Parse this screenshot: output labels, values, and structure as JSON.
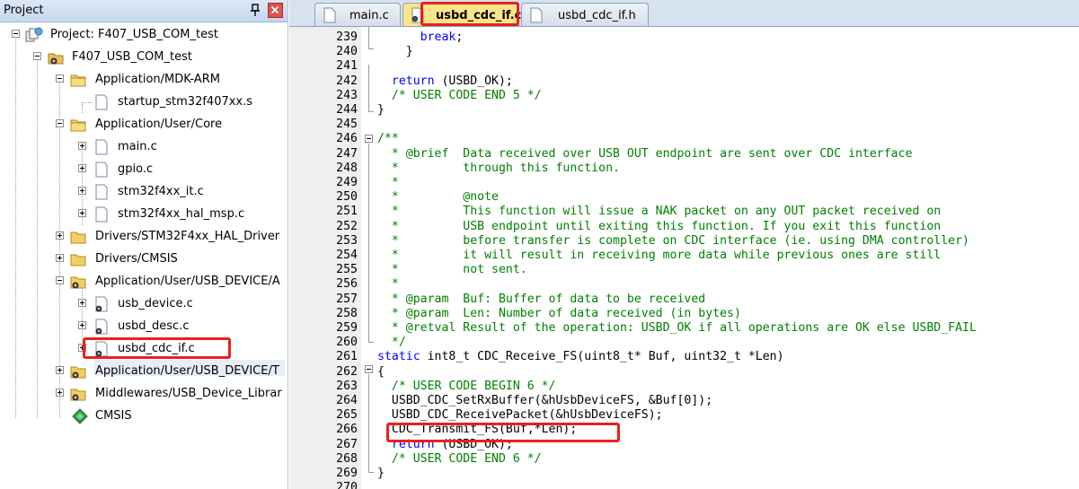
{
  "project_panel": {
    "title": "Project",
    "items": [
      {
        "label": "Project: F407_USB_COM_test",
        "icon": "project-icon"
      },
      {
        "label": "F407_USB_COM_test",
        "icon": "target-icon"
      },
      {
        "label": "Application/MDK-ARM",
        "icon": "folder-icon"
      },
      {
        "label": "startup_stm32f407xx.s",
        "icon": "file-icon"
      },
      {
        "label": "Application/User/Core",
        "icon": "folder-icon"
      },
      {
        "label": "main.c",
        "icon": "file-icon"
      },
      {
        "label": "gpio.c",
        "icon": "file-icon"
      },
      {
        "label": "stm32f4xx_it.c",
        "icon": "file-icon"
      },
      {
        "label": "stm32f4xx_hal_msp.c",
        "icon": "file-icon"
      },
      {
        "label": "Drivers/STM32F4xx_HAL_Driver",
        "icon": "folder-icon"
      },
      {
        "label": "Drivers/CMSIS",
        "icon": "folder-icon"
      },
      {
        "label": "Application/User/USB_DEVICE/A",
        "icon": "folder-gear-icon"
      },
      {
        "label": "usb_device.c",
        "icon": "file-gear-icon"
      },
      {
        "label": "usbd_desc.c",
        "icon": "file-gear-icon"
      },
      {
        "label": "usbd_cdc_if.c",
        "icon": "file-gear-icon"
      },
      {
        "label": "Application/User/USB_DEVICE/T",
        "icon": "folder-gear-icon"
      },
      {
        "label": "Middlewares/USB_Device_Librar",
        "icon": "folder-gear-icon"
      },
      {
        "label": "CMSIS",
        "icon": "gem-icon"
      }
    ]
  },
  "tabs": [
    {
      "label": "main.c",
      "icon": "file-icon"
    },
    {
      "label": "usbd_cdc_if.c",
      "icon": "file-gear-icon"
    },
    {
      "label": "usbd_cdc_if.h",
      "icon": "file-icon"
    }
  ],
  "colors": {
    "keyword": "#0000ff",
    "comment": "#008000",
    "highlight": "#e8211c",
    "active_tab": "#fbe58a"
  },
  "code": [
    {
      "n": "239",
      "parts": [
        [
          "      ",
          "pl"
        ],
        [
          "break",
          "kw"
        ],
        [
          ";",
          "pl"
        ]
      ]
    },
    {
      "n": "240",
      "parts": [
        [
          "    }",
          "pl"
        ]
      ]
    },
    {
      "n": "241",
      "parts": [
        [
          "",
          "pl"
        ]
      ]
    },
    {
      "n": "242",
      "parts": [
        [
          "  ",
          "pl"
        ],
        [
          "return",
          "kw"
        ],
        [
          " (USBD_OK);",
          "pl"
        ]
      ]
    },
    {
      "n": "243",
      "parts": [
        [
          "  ",
          "pl"
        ],
        [
          "/* USER CODE END 5 */",
          "cm"
        ]
      ]
    },
    {
      "n": "244",
      "parts": [
        [
          "}",
          "pl"
        ]
      ]
    },
    {
      "n": "245",
      "parts": [
        [
          "",
          "pl"
        ]
      ]
    },
    {
      "n": "246",
      "parts": [
        [
          "/**",
          "cm"
        ]
      ]
    },
    {
      "n": "247",
      "parts": [
        [
          "  * @brief  Data received over USB OUT endpoint are sent over CDC interface",
          "cm"
        ]
      ]
    },
    {
      "n": "248",
      "parts": [
        [
          "  *         through this function.",
          "cm"
        ]
      ]
    },
    {
      "n": "249",
      "parts": [
        [
          "  *",
          "cm"
        ]
      ]
    },
    {
      "n": "250",
      "parts": [
        [
          "  *         @note",
          "cm"
        ]
      ]
    },
    {
      "n": "251",
      "parts": [
        [
          "  *         This function will issue a NAK packet on any OUT packet received on",
          "cm"
        ]
      ]
    },
    {
      "n": "252",
      "parts": [
        [
          "  *         USB endpoint until exiting this function. If you exit this function",
          "cm"
        ]
      ]
    },
    {
      "n": "253",
      "parts": [
        [
          "  *         before transfer is complete on CDC interface (ie. using DMA controller)",
          "cm"
        ]
      ]
    },
    {
      "n": "254",
      "parts": [
        [
          "  *         it will result in receiving more data while previous ones are still",
          "cm"
        ]
      ]
    },
    {
      "n": "255",
      "parts": [
        [
          "  *         not sent.",
          "cm"
        ]
      ]
    },
    {
      "n": "256",
      "parts": [
        [
          "  *",
          "cm"
        ]
      ]
    },
    {
      "n": "257",
      "parts": [
        [
          "  * @param  Buf: Buffer of data to be received",
          "cm"
        ]
      ]
    },
    {
      "n": "258",
      "parts": [
        [
          "  * @param  Len: Number of data received (in bytes)",
          "cm"
        ]
      ]
    },
    {
      "n": "259",
      "parts": [
        [
          "  * @retval Result of the operation: USBD_OK if all operations are OK else USBD_FAIL",
          "cm"
        ]
      ]
    },
    {
      "n": "260",
      "parts": [
        [
          "  */",
          "cm"
        ]
      ]
    },
    {
      "n": "261",
      "parts": [
        [
          "static",
          "kw"
        ],
        [
          " int8_t CDC_Receive_FS(uint8_t* Buf, uint32_t *Len)",
          "pl"
        ]
      ]
    },
    {
      "n": "262",
      "parts": [
        [
          "{",
          "pl"
        ]
      ]
    },
    {
      "n": "263",
      "parts": [
        [
          "  ",
          "pl"
        ],
        [
          "/* USER CODE BEGIN 6 */",
          "cm"
        ]
      ]
    },
    {
      "n": "264",
      "parts": [
        [
          "  USBD_CDC_SetRxBuffer(&hUsbDeviceFS, &Buf[0]);",
          "pl"
        ]
      ]
    },
    {
      "n": "265",
      "parts": [
        [
          "  USBD_CDC_ReceivePacket(&hUsbDeviceFS);",
          "pl"
        ]
      ]
    },
    {
      "n": "266",
      "parts": [
        [
          "  CDC_Transmit_FS(Buf,*Len);",
          "pl"
        ]
      ]
    },
    {
      "n": "267",
      "parts": [
        [
          "  ",
          "pl"
        ],
        [
          "return",
          "kw"
        ],
        [
          " (USBD_OK);",
          "pl"
        ]
      ]
    },
    {
      "n": "268",
      "parts": [
        [
          "  ",
          "pl"
        ],
        [
          "/* USER CODE END 6 */",
          "cm"
        ]
      ]
    },
    {
      "n": "269",
      "parts": [
        [
          "}",
          "pl"
        ]
      ]
    },
    {
      "n": "270",
      "parts": [
        [
          "",
          "pl"
        ]
      ]
    }
  ]
}
